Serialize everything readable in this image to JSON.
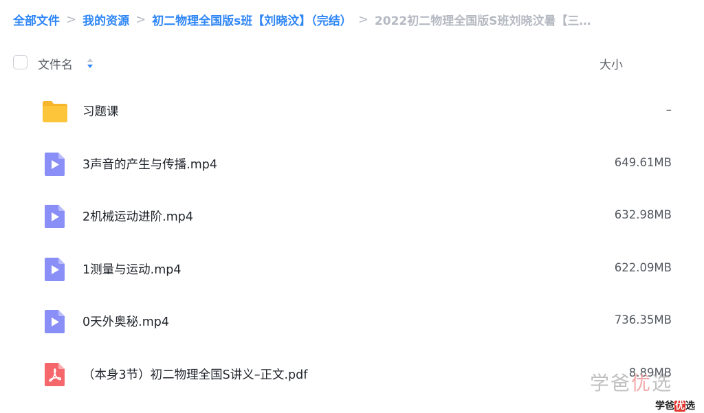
{
  "breadcrumb": [
    {
      "label": "全部文件",
      "current": false
    },
    {
      "label": "我的资源",
      "current": false
    },
    {
      "label": "初二物理全国版s班【刘晓汶】（完结）",
      "current": false
    },
    {
      "label": "2022初二物理全国版S班刘晓汶暑【三…",
      "current": true
    }
  ],
  "breadcrumb_separator": ">",
  "header": {
    "name_label": "文件名",
    "size_label": "大小"
  },
  "files": [
    {
      "name": "习题课",
      "size": "–",
      "type": "folder",
      "icon": "folder-icon"
    },
    {
      "name": "3声音的产生与传播.mp4",
      "size": "649.61MB",
      "type": "video",
      "icon": "video-file-icon"
    },
    {
      "name": "2机械运动进阶.mp4",
      "size": "632.98MB",
      "type": "video",
      "icon": "video-file-icon"
    },
    {
      "name": "1测量与运动.mp4",
      "size": "622.09MB",
      "type": "video",
      "icon": "video-file-icon"
    },
    {
      "name": "0天外奥秘.mp4",
      "size": "736.35MB",
      "type": "video",
      "icon": "video-file-icon"
    },
    {
      "name": "（本身3节）初二物理全国S讲义–正文.pdf",
      "size": "8.89MB",
      "type": "pdf",
      "icon": "pdf-file-icon"
    }
  ],
  "watermark": {
    "large_a": "学爸",
    "large_b": "优",
    "large_c": "选",
    "small_a": "学爸",
    "small_b": "优",
    "small_c": "选"
  },
  "colors": {
    "link": "#2e86f6",
    "muted": "#b5b9c2",
    "folder": "#fcc53a",
    "video": "#8a8ff8",
    "pdf": "#f6676b"
  }
}
